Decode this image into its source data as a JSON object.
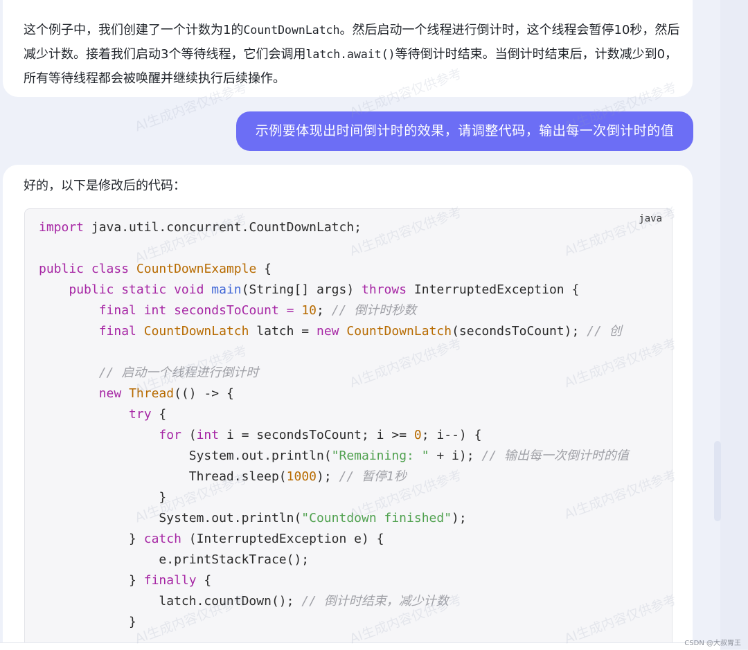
{
  "previous_message": {
    "p1": "这个例子中，我们创建了一个计数为1的",
    "c1": "CountDownLatch",
    "p2": "。然后启动一个线程进行倒计时，这个线程会暂停10秒，然后减少计数。接着我们启动3个等待线程，它们会调用",
    "c2": "latch.await()",
    "p3": "等待倒计时结束。当倒计时结束后，计数减少到0，所有等待线程都会被唤醒并继续执行后续操作。"
  },
  "user_message": "示例要体现出时间倒计时的效果，请调整代码，输出每一次倒计时的值",
  "reply": {
    "intro": "好的，以下是修改后的代码：",
    "language": "java",
    "code": {
      "l1_import": "import",
      "l1_rest": " java.util.concurrent.CountDownLatch;",
      "l3_public": "public",
      "l3_class": "class",
      "l3_name": "CountDownExample",
      "l3_rest": " {",
      "l4_mods": "public static void",
      "l4_main": "main",
      "l4_args": "(String[] args) ",
      "l4_throws": "throws",
      "l4_rest": " InterruptedException {",
      "l5_mods": "final int",
      "l5_mid": " secondsToCount = ",
      "l5_num": "10",
      "l5_semi": "; ",
      "l5_cmt": "// 倒计时秒数",
      "l6_final": "final",
      "l6_type": "CountDownLatch",
      "l6_mid": " latch = ",
      "l6_new": "new",
      "l6_ctor": "CountDownLatch",
      "l6_rest": "(secondsToCount); ",
      "l6_cmt": "// 创",
      "l8_cmt": "// 启动一个线程进行倒计时",
      "l9_new": "new",
      "l9_thread": "Thread",
      "l9_rest": "(() -> {",
      "l10_try": "try",
      "l10_rest": " {",
      "l11_for": "for",
      "l11_a": " (",
      "l11_int": "int",
      "l11_b": " i = secondsToCount; i >= ",
      "l11_zero": "0",
      "l11_c": "; i--) {",
      "l12_a": "System.out.println(",
      "l12_str": "\"Remaining: \"",
      "l12_b": " + i); ",
      "l12_cmt": "// 输出每一次倒计时的值",
      "l13_a": "Thread.sleep(",
      "l13_num": "1000",
      "l13_b": "); ",
      "l13_cmt": "// 暂停1秒",
      "l14": "}",
      "l15_a": "System.out.println(",
      "l15_str": "\"Countdown finished\"",
      "l15_b": ");",
      "l16_a": "} ",
      "l16_catch": "catch",
      "l16_b": " (InterruptedException e) {",
      "l17": "e.printStackTrace();",
      "l18_a": "} ",
      "l18_finally": "finally",
      "l18_b": " {",
      "l19_a": "latch.countDown(); ",
      "l19_cmt": "// 倒计时结束，减少计数",
      "l20": "}"
    }
  },
  "watermark": "AI生成内容仅供参考",
  "credit": "CSDN @大叔胃王"
}
